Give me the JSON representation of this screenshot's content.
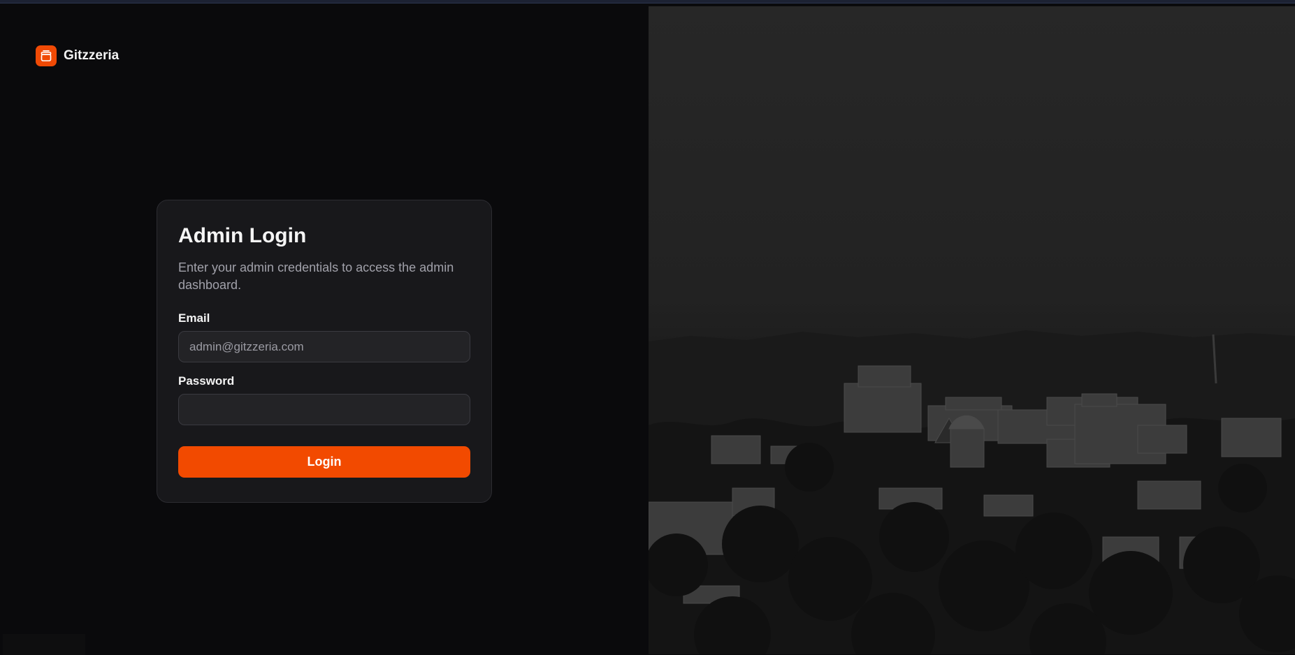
{
  "brand": {
    "name": "Gitzzeria",
    "logo_icon": "gift-icon",
    "accent_color": "#f04a05"
  },
  "login_card": {
    "title": "Admin Login",
    "description": "Enter your admin credentials to access the admin dashboard.",
    "email_label": "Email",
    "email_placeholder": "admin@gitzzeria.com",
    "email_value": "",
    "password_label": "Password",
    "password_value": "",
    "login_label": "Login"
  },
  "hero_image": {
    "description_icon": "campus-aerial-photo"
  }
}
